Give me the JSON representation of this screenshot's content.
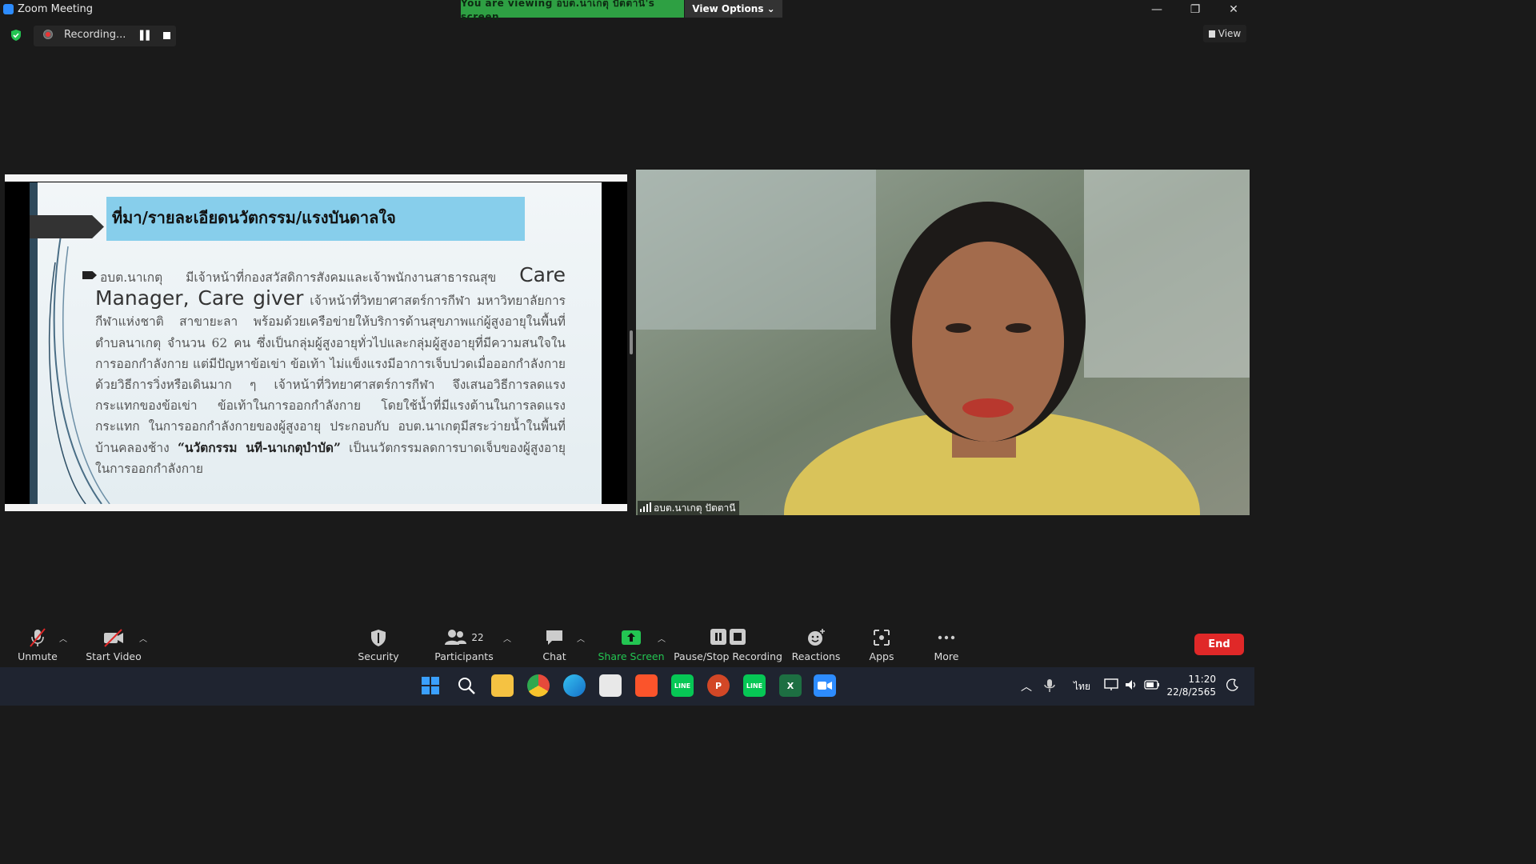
{
  "window": {
    "title": "Zoom Meeting",
    "viewing_banner": "You are viewing อบต.นาเกตุ ปัตตานี's screen",
    "view_options": "View Options ⌄",
    "controls": [
      "—",
      "❐",
      "✕"
    ]
  },
  "recording": {
    "label": "Recording..."
  },
  "view_button": "View",
  "shared_screen": {
    "slide": {
      "title": "ที่มา/รายละเอียดนวัตกรรม/แรงบันดาลใจ",
      "body_part1": "อบต.นาเกตุ มีเจ้าหน้าที่กองสวัสดิการสังคมและเจ้าพนักงานสาธารณสุข ",
      "body_big": "Care Manager, Care giver",
      "body_part2": " เจ้าหน้าที่วิทยาศาสตร์การกีฬา มหาวิทยาลัยการกีฬาแห่งชาติ สาขายะลา พร้อมด้วยเครือข่ายให้บริการด้านสุขภาพแก่ผู้สูงอายุในพื้นที่ตำบลนาเกตุ จำนวน 62 คน ซึ่งเป็นกลุ่มผู้สูงอายุทั่วไปและกลุ่มผู้สูงอายุที่มีความสนใจในการออกกำลังกาย แต่มีปัญหาข้อเข่า ข้อเท้า ไม่แข็งแรงมีอาการเจ็บปวดเมื่อออกกำลังกายด้วยวิธีการวิ่งหรือเดินมาก ๆ เจ้าหน้าที่วิทยาศาสตร์การกีฬา จึงเสนอวิธีการลดแรงกระแทกของข้อเข่า ข้อเท้าในการออกกำลังกาย โดยใช้น้ำที่มีแรงต้านในการลดแรงกระแทก ในการออกกำลังกายของผู้สูงอายุ ประกอบกับ อบต.นาเกตุมีสระว่ายน้ำในพื้นที่บ้านคลองช้าง ",
      "body_bold": "“นวัตกรรม นที-นาเกตุบำบัด”",
      "body_part3": " เป็นนวัตกรรมลดการบาดเจ็บของผู้สูงอายุในการออกกำลังกาย"
    }
  },
  "video": {
    "participant_name": "อบต.นาเกตุ ปัตตานี"
  },
  "toolbar": {
    "unmute": "Unmute",
    "start_video": "Start Video",
    "security": "Security",
    "participants": "Participants",
    "participants_count": "22",
    "chat": "Chat",
    "share_screen": "Share Screen",
    "pause_stop_recording": "Pause/Stop Recording",
    "reactions": "Reactions",
    "apps": "Apps",
    "more": "More",
    "end": "End"
  },
  "taskbar": {
    "language": "ไทย",
    "time": "11:20",
    "date": "22/8/2565"
  },
  "colors": {
    "viewing_banner": "#2ea043",
    "share_screen_icon": "#23c552",
    "end_button": "#e02828",
    "slide_header": "#87ceeb"
  }
}
